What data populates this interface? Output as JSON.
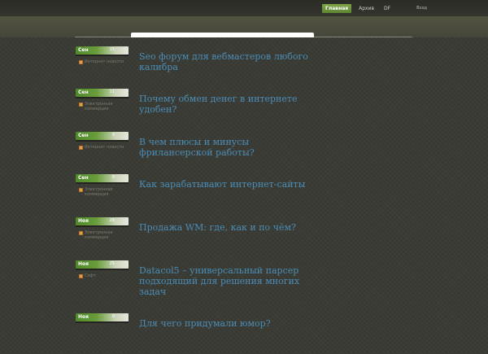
{
  "nav": {
    "items": [
      {
        "label": "Главная",
        "active": true
      },
      {
        "label": "Архив",
        "active": false
      },
      {
        "label": "DF",
        "active": false
      }
    ],
    "login": "Вход"
  },
  "posts": [
    {
      "month": "Сен",
      "day": "15",
      "category": "Интернет новости",
      "title": "Seo форум для вебмастеров любого калибра"
    },
    {
      "month": "Сен",
      "day": "11",
      "category": "Электронная коммерция",
      "title": "Почему обмен денег в интернете удобен?"
    },
    {
      "month": "Сен",
      "day": "9",
      "category": "Интернет новости",
      "title": "В чем плюсы и минусы фрилансерской работы?"
    },
    {
      "month": "Сен",
      "day": "8",
      "category": "Электронная коммерция",
      "title": "Как зарабатывают интернет-сайты"
    },
    {
      "month": "Ноя",
      "day": "26",
      "category": "Электронная коммерция",
      "title": "Продажа WM: где, как и по чём?"
    },
    {
      "month": "Ноя",
      "day": "25",
      "category": "Софт",
      "title": "Datacol5 – универсальный парсер подходящий для решения многих задач"
    },
    {
      "month": "Ноя",
      "day": "8",
      "category": "",
      "title": "Для чего придумали юмор?"
    }
  ],
  "colors": {
    "accent": "#6a9d3c",
    "link": "#4b8db7",
    "background": "#3a3b34"
  }
}
